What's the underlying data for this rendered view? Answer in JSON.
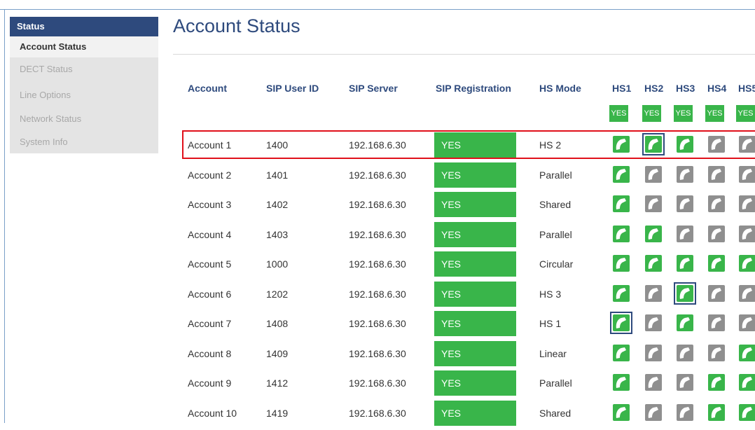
{
  "sidebar": {
    "header": "Status",
    "items": [
      {
        "label": "Account Status",
        "active": true
      },
      {
        "label": "DECT Status",
        "active": false
      },
      {
        "label": "Line Options",
        "active": false
      },
      {
        "label": "Network Status",
        "active": false
      },
      {
        "label": "System Info",
        "active": false
      }
    ]
  },
  "page_title": "Account Status",
  "columns": {
    "account": "Account",
    "sip_user_id": "SIP User ID",
    "sip_server": "SIP Server",
    "sip_registration": "SIP Registration",
    "hs_mode": "HS Mode",
    "handsets": [
      "HS1",
      "HS2",
      "HS3",
      "HS4",
      "HS5"
    ]
  },
  "handset_registered": [
    "YES",
    "YES",
    "YES",
    "YES",
    "YES"
  ],
  "colors": {
    "accent": "#2e4a7d",
    "green": "#39b54a",
    "gray": "#8f8f8f",
    "highlight": "#e0101a"
  },
  "rows": [
    {
      "account": "Account 1",
      "sip_user_id": "1400",
      "sip_server": "192.168.6.30",
      "registration": "YES",
      "hs_mode": "HS 2",
      "handsets": [
        1,
        1,
        1,
        0,
        0
      ],
      "selected_handset": 1,
      "highlighted": true
    },
    {
      "account": "Account 2",
      "sip_user_id": "1401",
      "sip_server": "192.168.6.30",
      "registration": "YES",
      "hs_mode": "Parallel",
      "handsets": [
        1,
        0,
        0,
        0,
        0
      ]
    },
    {
      "account": "Account 3",
      "sip_user_id": "1402",
      "sip_server": "192.168.6.30",
      "registration": "YES",
      "hs_mode": "Shared",
      "handsets": [
        1,
        0,
        0,
        0,
        0
      ]
    },
    {
      "account": "Account 4",
      "sip_user_id": "1403",
      "sip_server": "192.168.6.30",
      "registration": "YES",
      "hs_mode": "Parallel",
      "handsets": [
        1,
        1,
        0,
        0,
        0
      ]
    },
    {
      "account": "Account 5",
      "sip_user_id": "1000",
      "sip_server": "192.168.6.30",
      "registration": "YES",
      "hs_mode": "Circular",
      "handsets": [
        1,
        1,
        1,
        1,
        1
      ]
    },
    {
      "account": "Account 6",
      "sip_user_id": "1202",
      "sip_server": "192.168.6.30",
      "registration": "YES",
      "hs_mode": "HS 3",
      "handsets": [
        1,
        0,
        1,
        0,
        0
      ],
      "selected_handset": 2
    },
    {
      "account": "Account 7",
      "sip_user_id": "1408",
      "sip_server": "192.168.6.30",
      "registration": "YES",
      "hs_mode": "HS 1",
      "handsets": [
        1,
        0,
        1,
        0,
        0
      ],
      "selected_handset": 0
    },
    {
      "account": "Account 8",
      "sip_user_id": "1409",
      "sip_server": "192.168.6.30",
      "registration": "YES",
      "hs_mode": "Linear",
      "handsets": [
        1,
        0,
        0,
        0,
        1
      ]
    },
    {
      "account": "Account 9",
      "sip_user_id": "1412",
      "sip_server": "192.168.6.30",
      "registration": "YES",
      "hs_mode": "Parallel",
      "handsets": [
        1,
        0,
        0,
        1,
        1
      ]
    },
    {
      "account": "Account 10",
      "sip_user_id": "1419",
      "sip_server": "192.168.6.30",
      "registration": "YES",
      "hs_mode": "Shared",
      "handsets": [
        1,
        0,
        0,
        1,
        1
      ]
    }
  ]
}
